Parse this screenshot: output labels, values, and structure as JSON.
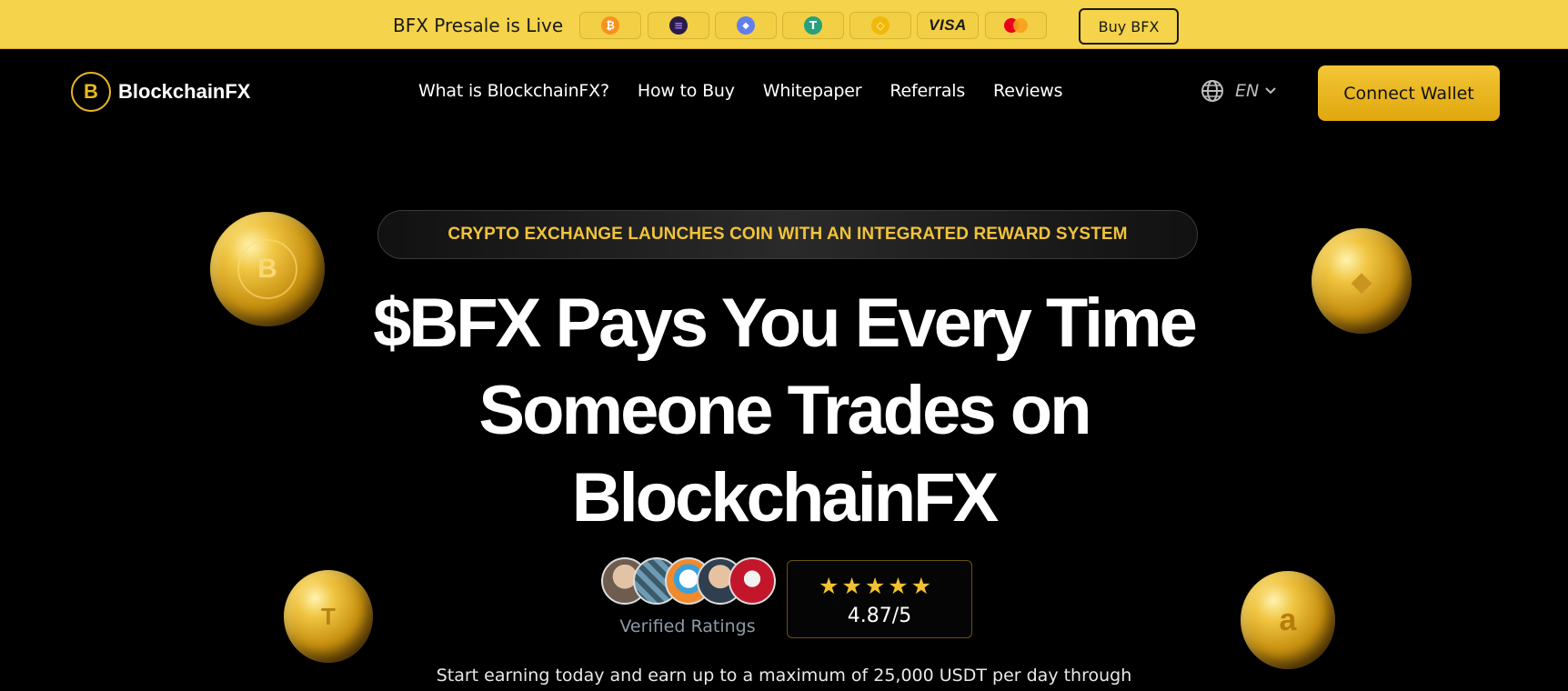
{
  "topbar": {
    "live_text": "BFX Presale is Live",
    "payments": [
      {
        "name": "bitcoin-icon",
        "glyph": "₿",
        "color": "#f7931a"
      },
      {
        "name": "solana-icon",
        "glyph": "≡",
        "color": "#2a1a4a"
      },
      {
        "name": "ethereum-icon",
        "glyph": "◆",
        "color": "#627eea"
      },
      {
        "name": "tether-icon",
        "glyph": "T",
        "color": "#26a17b"
      },
      {
        "name": "bnb-icon",
        "glyph": "◇",
        "color": "#f0b90b"
      },
      {
        "name": "visa-icon",
        "glyph": "VISA",
        "color": "#1a1a1a"
      },
      {
        "name": "mastercard-icon",
        "glyph": "",
        "color": "#eb001b"
      }
    ],
    "buy_label": "Buy BFX"
  },
  "nav": {
    "logo_text": "BlockchainFX",
    "logo_glyph": "B",
    "links": [
      "What is BlockchainFX?",
      "How to Buy",
      "Whitepaper",
      "Referrals",
      "Reviews"
    ],
    "language": "EN",
    "connect_label": "Connect Wallet"
  },
  "hero": {
    "pill_text": "CRYPTO EXCHANGE LAUNCHES COIN WITH AN INTEGRATED REWARD SYSTEM",
    "headline_lines": [
      "$BFX Pays You Every Time",
      "Someone Trades on",
      "BlockchainFX"
    ],
    "verified_label": "Verified Ratings",
    "stars": "★★★★★",
    "rating": "4.87/5",
    "rating_stars_value": 4.87,
    "subtext": "Start earning today and earn up to a maximum of 25,000 USDT per day through"
  },
  "coins": [
    {
      "name": "bfx-coin-icon",
      "glyph": "B"
    },
    {
      "name": "ethereum-coin-icon",
      "glyph": "◆"
    },
    {
      "name": "tesla-coin-icon",
      "glyph": "T"
    },
    {
      "name": "amazon-coin-icon",
      "glyph": "a"
    }
  ],
  "colors": {
    "banner": "#f5d34a",
    "accent": "#f2c132",
    "background": "#000000"
  }
}
